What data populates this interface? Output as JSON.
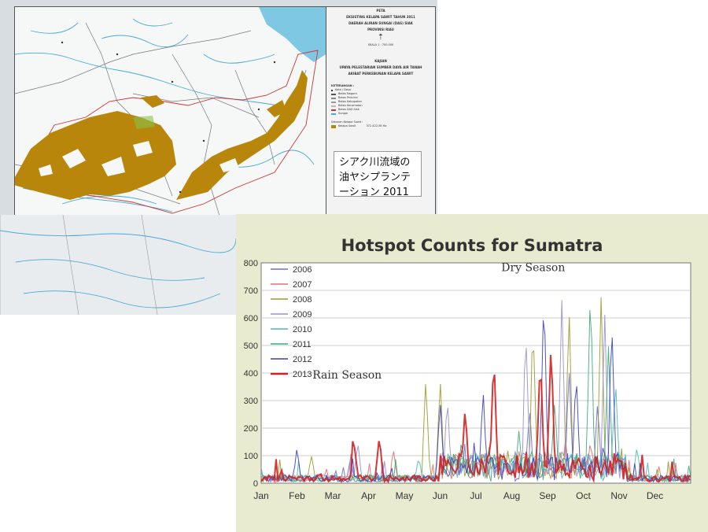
{
  "map": {
    "legend_title_lines": [
      "PETA",
      "EKSISTING KELAPA SAWIT TAHUN 2011",
      "DAERAH ALIRAN SUNGAI (DAS) SIAK",
      "PROVINSI RIAU"
    ],
    "scale": "SKALA 1 : 700.000",
    "study_lines": [
      "KAJIAN",
      "UPAYA PELESTARIAN SUMBER DAYA AIR TANAH",
      "AKIBAT PERKEBUNAN KELAPA SAWIT"
    ],
    "keterangan": "KETERANGAN :",
    "legend_items": [
      "Kota / Desa",
      "Batas Negara",
      "Batas Provinsi",
      "Batas Kabupaten",
      "Batas Kecamatan",
      "Batas DAS Siak",
      "Sungai"
    ],
    "sebaran_label": "Sebaran Kelapa Sawit :",
    "sebaran_item": "Kelapa Sawit",
    "sebaran_area": "372.422,58 Ha",
    "caption_lines": [
      "シアク川流域の",
      "油ヤシプランテ",
      "ーション 2011"
    ],
    "colors": {
      "palm": "#b8860b",
      "river": "#49a9d6",
      "sea": "#7ec8e3",
      "border": "#cc3333"
    }
  },
  "chart_data": {
    "type": "line",
    "title": "Hotspot Counts for Sumatra",
    "xlabel": "",
    "ylabel": "",
    "ylim": [
      0,
      800
    ],
    "yticks": [
      "0",
      "100",
      "200",
      "300",
      "400",
      "500",
      "600",
      "700",
      "800"
    ],
    "months": [
      "Jan",
      "Feb",
      "Mar",
      "Apr",
      "May",
      "Jun",
      "Jul",
      "Aug",
      "Sep",
      "Oct",
      "Nov",
      "Dec"
    ],
    "grid": true,
    "legend_position": "top-left",
    "annotations": [
      {
        "text": "Dry Season",
        "x_month": 7.6,
        "y": 770
      },
      {
        "text": "Rain Season",
        "x_month": 2.4,
        "y": 380
      }
    ],
    "series": [
      {
        "name": "2006",
        "color": "#6a6fd6",
        "peaks": [
          [
            2.5,
            90
          ],
          [
            7.5,
            280
          ],
          [
            8.6,
            420
          ],
          [
            9.4,
            300
          ]
        ]
      },
      {
        "name": "2007",
        "color": "#e07070",
        "peaks": [
          [
            3.7,
            110
          ],
          [
            8.5,
            160
          ],
          [
            9.2,
            150
          ]
        ]
      },
      {
        "name": "2008",
        "color": "#9a9a30",
        "peaks": [
          [
            1.4,
            100
          ],
          [
            4.6,
            385
          ],
          [
            5.0,
            380
          ],
          [
            7.6,
            550
          ],
          [
            8.6,
            640
          ],
          [
            9.5,
            700
          ]
        ]
      },
      {
        "name": "2009",
        "color": "#9a8fd0",
        "peaks": [
          [
            2.7,
            150
          ],
          [
            5.2,
            310
          ],
          [
            7.4,
            520
          ],
          [
            8.4,
            660
          ],
          [
            9.6,
            610
          ]
        ]
      },
      {
        "name": "2010",
        "color": "#4fb9b9",
        "peaks": [
          [
            4.4,
            90
          ],
          [
            8.8,
            120
          ],
          [
            9.9,
            380
          ],
          [
            10.5,
            130
          ]
        ]
      },
      {
        "name": "2011",
        "color": "#3faa7c",
        "peaks": [
          [
            5.6,
            160
          ],
          [
            7.2,
            190
          ],
          [
            8.2,
            300
          ],
          [
            9.2,
            730
          ],
          [
            9.7,
            510
          ]
        ]
      },
      {
        "name": "2012",
        "color": "#3b3fbf",
        "peaks": [
          [
            1.0,
            120
          ],
          [
            5.0,
            300
          ],
          [
            6.2,
            340
          ],
          [
            7.9,
            720
          ],
          [
            8.8,
            410
          ],
          [
            9.8,
            560
          ]
        ]
      },
      {
        "name": "2013",
        "color": "#d42020",
        "peaks": [
          [
            2.6,
            130
          ],
          [
            3.3,
            170
          ],
          [
            5.7,
            280
          ],
          [
            6.5,
            480
          ],
          [
            7.8,
            470
          ],
          [
            8.1,
            520
          ]
        ]
      }
    ]
  }
}
